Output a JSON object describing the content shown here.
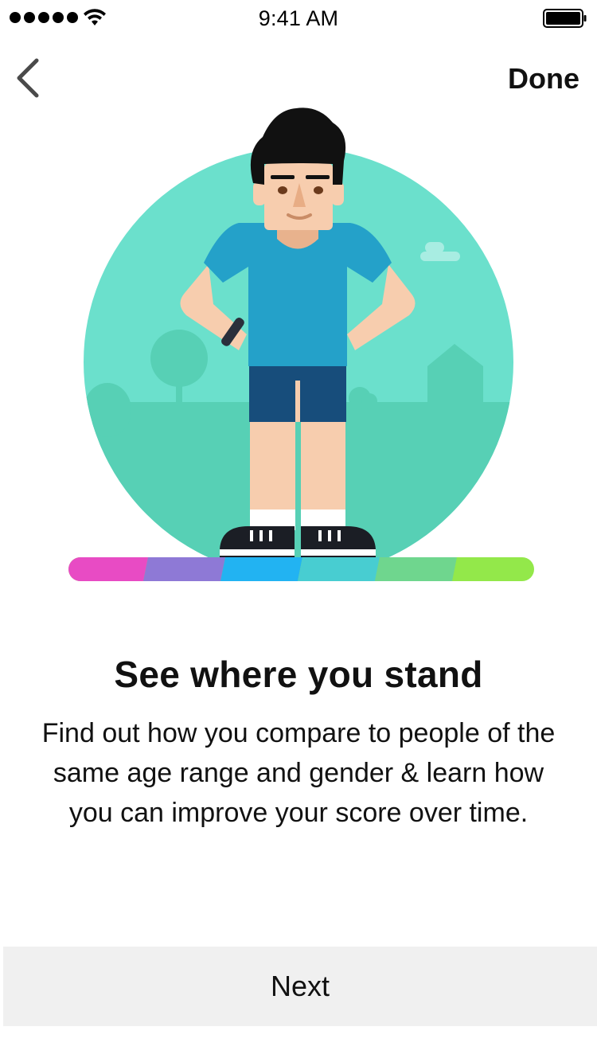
{
  "status_bar": {
    "time": "9:41 AM",
    "signal_icon": "signal-dots-icon",
    "wifi_icon": "wifi-icon",
    "battery_icon": "battery-icon"
  },
  "nav": {
    "back_icon": "chevron-left-icon",
    "done_label": "Done"
  },
  "illustration": {
    "name": "person-standing-illustration",
    "scale_bar_colors": [
      "#e84bc4",
      "#8e79d6",
      "#22b3f2",
      "#48cdd1",
      "#6fd68e",
      "#93e84a"
    ]
  },
  "content": {
    "headline": "See where you stand",
    "body": "Find out how you compare to people of the same age range and gender & learn how you can improve your score over time."
  },
  "footer": {
    "next_label": "Next"
  },
  "colors": {
    "circle_bg": "#6be0cc",
    "landscape": "#57d0b5",
    "shirt": "#24a1c9",
    "shorts": "#174d7b",
    "skin": "#f7cdae",
    "button_bg": "#f0f0f0"
  }
}
